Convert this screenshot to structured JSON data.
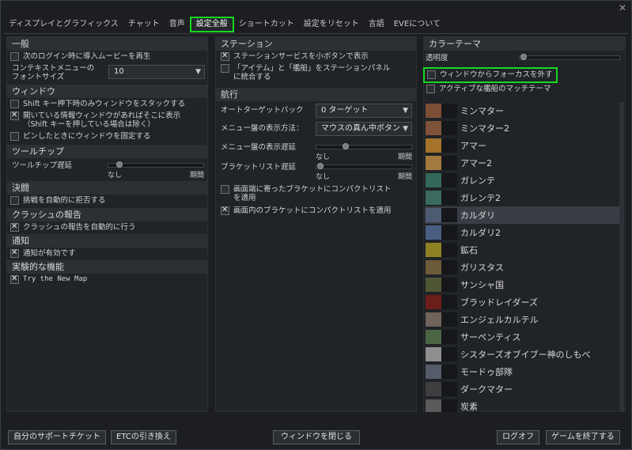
{
  "tabs": [
    {
      "label": "ディスプレイとグラフィックス"
    },
    {
      "label": "チャット"
    },
    {
      "label": "音声"
    },
    {
      "label": "設定全般"
    },
    {
      "label": "ショートカット"
    },
    {
      "label": "設定をリセット"
    },
    {
      "label": "言語"
    },
    {
      "label": "EVEについて"
    }
  ],
  "close_glyph": "✕",
  "general": {
    "title": "一般",
    "intro_movie": "次のログイン時に導入ムービーを再生",
    "context_menu_label": "コンテキストメニューの\nフォントサイズ",
    "context_menu_value": "10"
  },
  "window": {
    "title": "ウィンドウ",
    "stack_shift": "Shift キー押下時のみウィンドウをスタックする",
    "show_info": "開いている情報ウィンドウがあればそこに表示",
    "show_info_sub": "（Shift キーを押している場合は除く）",
    "pin_window": "ピンしたときにウィンドウを固定する"
  },
  "tooltip": {
    "title": "ツールチップ",
    "delay_label": "ツールチップ遅延",
    "min": "なし",
    "max": "期間",
    "level": 0.1
  },
  "duel": {
    "title": "決闘",
    "auto_reject": "挑戦を自動的に拒否する"
  },
  "crash": {
    "title": "クラッシュの報告",
    "auto_report": "クラッシュの報告を自動的に行う"
  },
  "notify": {
    "title": "通知",
    "enabled": "通知が有効です"
  },
  "experimental": {
    "title": "実験的な機能",
    "new_map": "Try the New Map"
  },
  "station": {
    "title": "ステーション",
    "small_buttons": "ステーションサービスを小ボタンで表示",
    "integrate": "「アイテム」と「艦船」をステーションパネル\nに統合する"
  },
  "navigation": {
    "title": "航行",
    "autotarget_label": "オートターゲットバック",
    "autotarget_value": "0 ターゲット",
    "menu_display_label": "メニュー盤の表示方法：",
    "menu_display_value": "マウスの真ん中ボタン",
    "menu_delay_label": "メニュー盤の表示遅延",
    "bracket_delay_label": "ブラケットリスト遅延",
    "min": "なし",
    "max": "期間",
    "menu_delay_level": 0.3,
    "bracket_delay_level": 0.02,
    "compact_edge": "画面端に寄ったブラケットにコンパクトリスト\nを適用",
    "compact_in": "画面内のブラケットにコンパクトリストを適用"
  },
  "color_theme": {
    "title": "カラーテーマ",
    "transparency_label": "透明度",
    "transparency_level": 0.02,
    "unfocus_opacity": "ウィンドウからフォーカスを外す",
    "match_ship": "アクティブな艦船のマッチテーマ",
    "themes": [
      {
        "name": "ミンマター",
        "color": "#7b4f36"
      },
      {
        "name": "ミンマター2",
        "color": "#7e5238"
      },
      {
        "name": "アマー",
        "color": "#a5732c"
      },
      {
        "name": "アマー2",
        "color": "#a27a3e"
      },
      {
        "name": "ガレンテ",
        "color": "#326759"
      },
      {
        "name": "ガレンテ2",
        "color": "#3a6b5e"
      },
      {
        "name": "カルダリ",
        "color": "#4c5a72"
      },
      {
        "name": "カルダリ2",
        "color": "#4a5e84"
      },
      {
        "name": "鉱石",
        "color": "#8c8224"
      },
      {
        "name": "ガリスタス",
        "color": "#6d5a38"
      },
      {
        "name": "サンシャ国",
        "color": "#4f5634"
      },
      {
        "name": "ブラッドレイダーズ",
        "color": "#6c1f1a"
      },
      {
        "name": "エンジェルカルテル",
        "color": "#6f635c"
      },
      {
        "name": "サーペンティス",
        "color": "#4b6442"
      },
      {
        "name": "シスターズオブイブー神のしもべ",
        "color": "#8e8e8e"
      },
      {
        "name": "モードゥ部隊",
        "color": "#565b6a"
      },
      {
        "name": "ダークマター",
        "color": "#3e3e3e"
      },
      {
        "name": "炭素",
        "color": "#5a5a5a"
      }
    ]
  },
  "footer": {
    "support_ticket": "自分のサポートチケット",
    "etc_redeem": "ETCの引き換え",
    "close_window": "ウィンドウを閉じる",
    "logoff": "ログオフ",
    "quit_game": "ゲームを終了する"
  },
  "colors": {
    "highlight": "#17d820",
    "panel": "#202327",
    "section": "#2c2f34"
  }
}
